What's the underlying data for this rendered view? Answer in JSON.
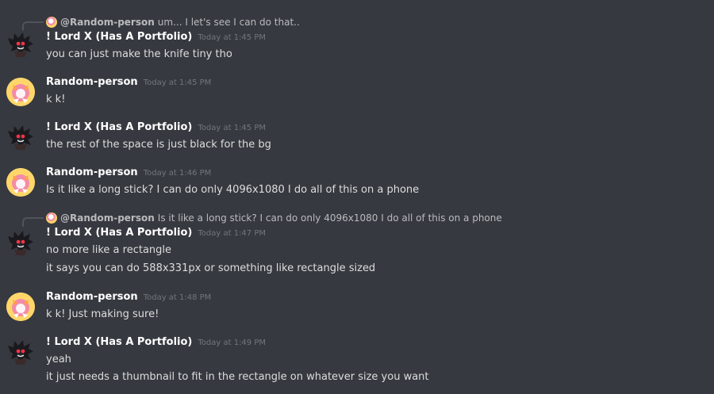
{
  "messages": [
    {
      "author": "! Lord X (Has A Portfolio)",
      "timestamp": "Today at 1:45 PM",
      "reply": {
        "author": "@Random-person",
        "text": "um... I let's see I can do that.."
      },
      "lines": [
        "you can just make the knife tiny tho"
      ],
      "avatar": "lord-x-avatar"
    },
    {
      "author": "Random-person",
      "timestamp": "Today at 1:45 PM",
      "lines": [
        "k k!"
      ],
      "avatar": "random-person-avatar"
    },
    {
      "author": "! Lord X (Has A Portfolio)",
      "timestamp": "Today at 1:45 PM",
      "lines": [
        "the rest of the space is just black for the bg"
      ],
      "avatar": "lord-x-avatar"
    },
    {
      "author": "Random-person",
      "timestamp": "Today at 1:46 PM",
      "lines": [
        "Is it like a long stick? I can do only 4096x1080 I do all of this on a phone"
      ],
      "avatar": "random-person-avatar"
    },
    {
      "author": "! Lord X (Has A Portfolio)",
      "timestamp": "Today at 1:47 PM",
      "reply": {
        "author": "@Random-person",
        "text": "Is it like a long stick? I can do only 4096x1080 I do all of this on a phone"
      },
      "lines": [
        "no more like a rectangle",
        "it says you can do 588x331px or something like rectangle sized"
      ],
      "avatar": "lord-x-avatar"
    },
    {
      "author": "Random-person",
      "timestamp": "Today at 1:48 PM",
      "lines": [
        "k k! Just making sure!"
      ],
      "avatar": "random-person-avatar"
    },
    {
      "author": "! Lord X (Has A Portfolio)",
      "timestamp": "Today at 1:49 PM",
      "lines": [
        "yeah",
        "it just needs a thumbnail to fit in the rectangle on whatever size you want"
      ],
      "avatar": "lord-x-avatar"
    }
  ]
}
